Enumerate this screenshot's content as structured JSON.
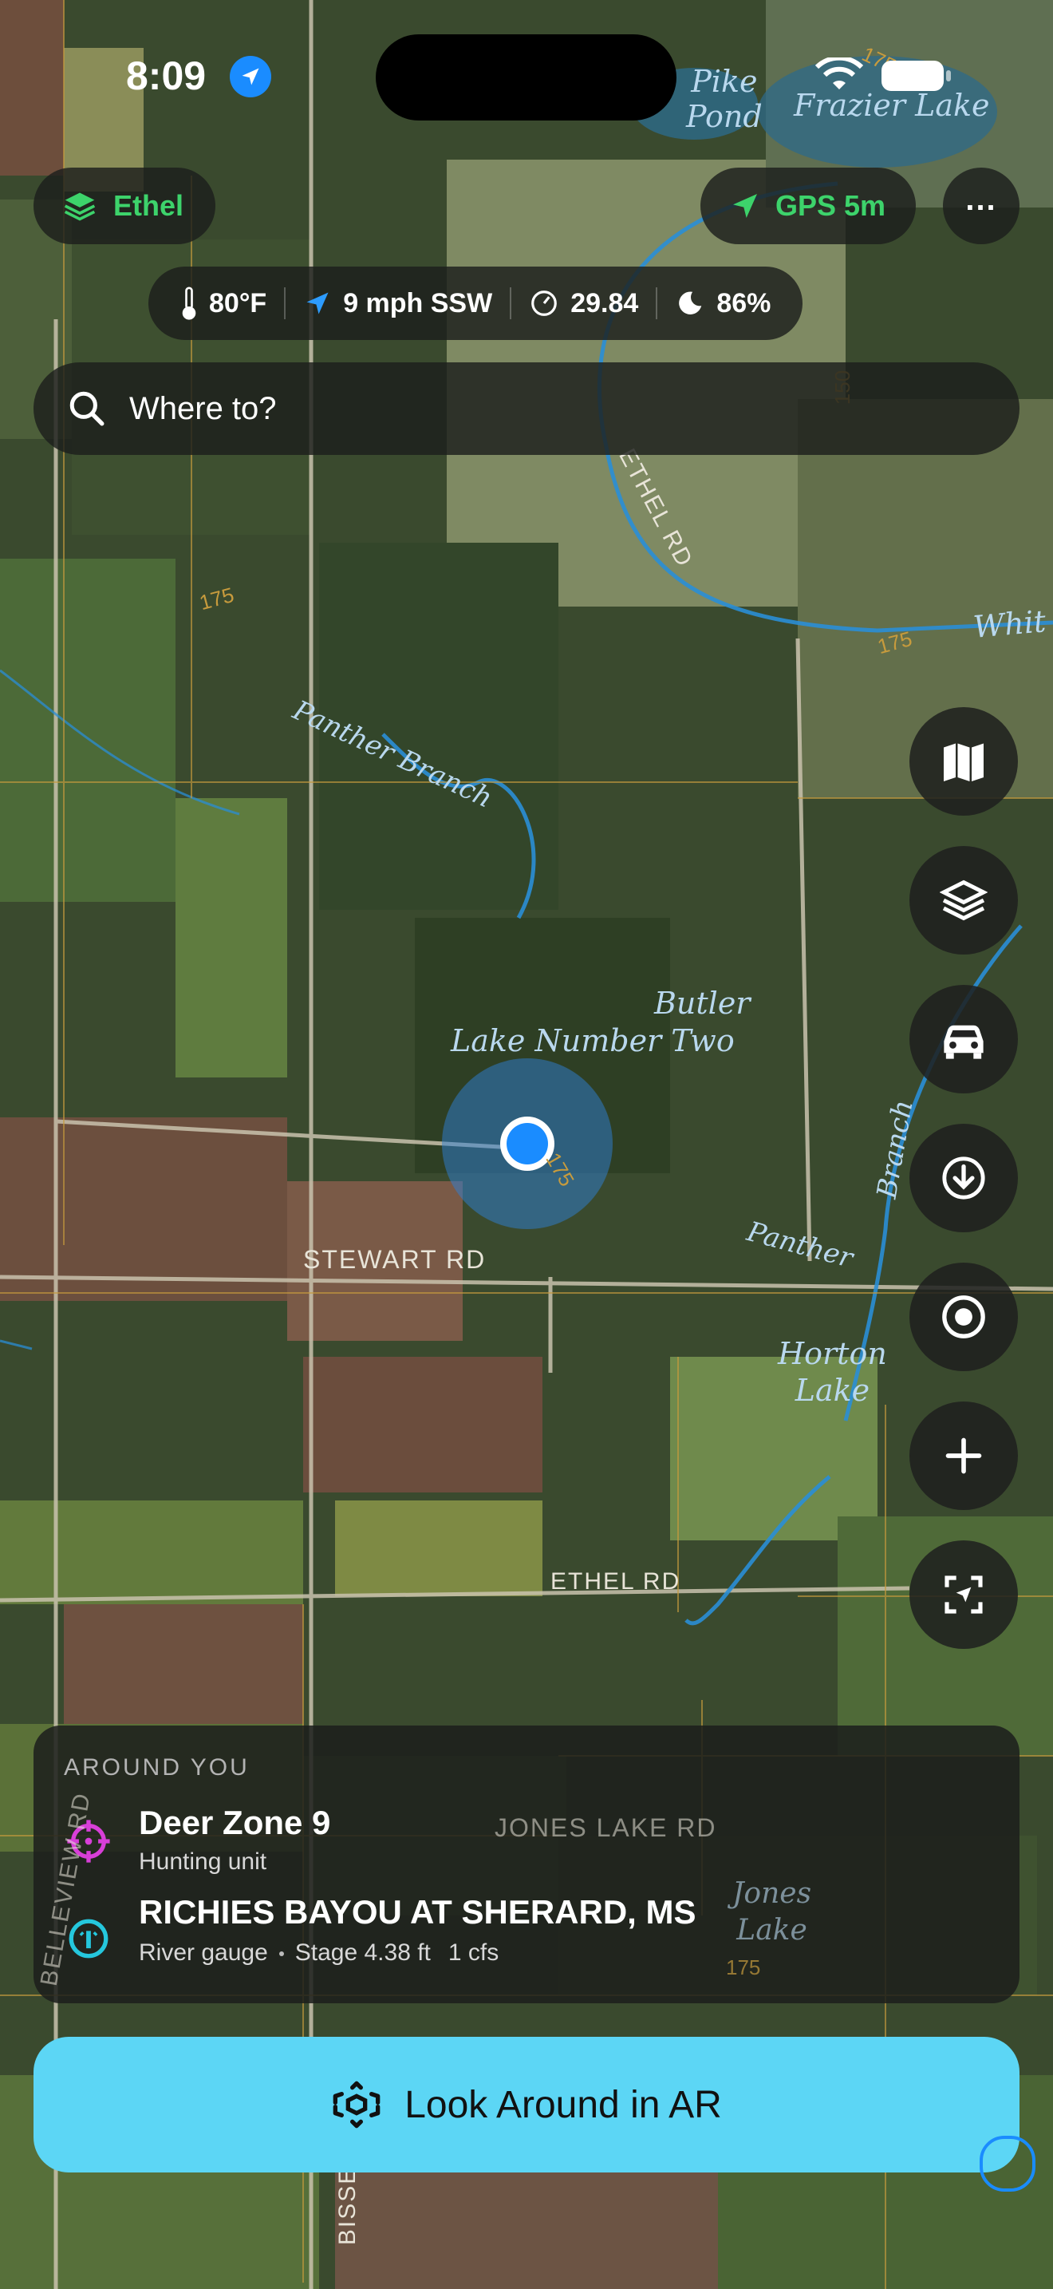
{
  "status_bar": {
    "time": "8:09"
  },
  "map": {
    "labels": {
      "pike_pond_1": "Pike",
      "pike_pond_2": "Pond",
      "frazier_lake": "Frazier Lake",
      "contour_175_top": "175",
      "contour_150": "150",
      "ethel_rd_curve": "ETHEL RD",
      "contour_175_left": "175",
      "contour_175_right": "175",
      "white_river": "Whit",
      "panther_branch_nw_1": "Panther Branch",
      "butler": "Butler",
      "lake_number_two": "Lake Number Two",
      "contour_175_center": "175",
      "panther_branch_east_1": "Branch",
      "panther_branch_east_2": "Panther",
      "stewart_rd": "STEWART RD",
      "horton_1": "Horton",
      "horton_2": "Lake",
      "ethel_rd_bottom": "ETHEL RD",
      "jones_lake_rd": "JONES LAKE RD",
      "belleview_rd": "BELLEVIEW RD",
      "jones_1": "Jones",
      "jones_2": "Lake",
      "contour_175_bottom": "175",
      "bissell_rd": "BISSELL RD"
    }
  },
  "top_bar": {
    "layer_label": "Ethel",
    "gps_label": "GPS 5m",
    "more_icon": "ellipsis-icon"
  },
  "weather": {
    "temperature": "80°F",
    "wind": "9 mph SSW",
    "pressure": "29.84",
    "moon": "86%"
  },
  "search": {
    "placeholder": "Where to?"
  },
  "right_controls": [
    "map-icon",
    "layers-icon",
    "car-icon",
    "download-icon",
    "locate-icon",
    "plus-icon",
    "ar-scan-icon"
  ],
  "around_you": {
    "header": "AROUND YOU",
    "items": [
      {
        "title": "Deer Zone 9",
        "subtitle": "Hunting unit"
      },
      {
        "title": "RICHIES BAYOU AT SHERARD, MS",
        "sub_type": "River gauge",
        "stage": "Stage 4.38 ft",
        "flow": "1 cfs"
      }
    ]
  },
  "ar_button": {
    "label": "Look Around in AR"
  },
  "colors": {
    "green_accent": "#3dd36b",
    "ar_button": "#5cd6f5",
    "location_dot": "#1a8cff",
    "hunting_icon": "#d83fd8",
    "gauge_icon": "#25c7dd"
  }
}
